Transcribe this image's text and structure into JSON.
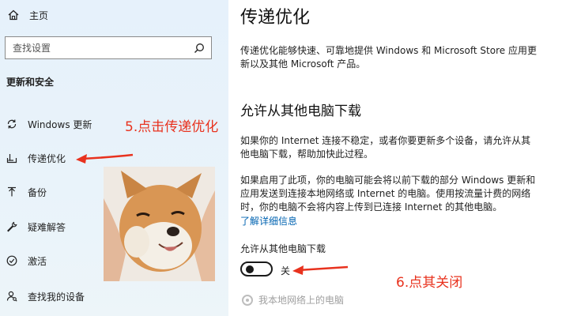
{
  "sidebar": {
    "home_label": "主页",
    "search_placeholder": "查找设置",
    "section_title": "更新和安全",
    "items": [
      {
        "label": "Windows 更新",
        "icon": "sync-icon"
      },
      {
        "label": "传递优化",
        "icon": "delivery-icon"
      },
      {
        "label": "备份",
        "icon": "backup-icon"
      },
      {
        "label": "疑难解答",
        "icon": "wrench-icon"
      },
      {
        "label": "激活",
        "icon": "check-circle-icon"
      },
      {
        "label": "查找我的设备",
        "icon": "person-locate-icon"
      }
    ]
  },
  "main": {
    "title": "传递优化",
    "desc_line1": "传递优化能够快速、可靠地提供 Windows 和 Microsoft Store 应用更",
    "desc_line2": "新以及其他 Microsoft 产品。",
    "section_heading": "允许从其他电脑下载",
    "para1_line1": "如果你的 Internet 连接不稳定，或者你要更新多个设备，请允许从其",
    "para1_line2": "他电脑下载，帮助加快此过程。",
    "para2_line1": "如果启用了此项，你的电脑可能会将以前下载的部分 Windows 更新和",
    "para2_line2": "应用发送到连接本地网络或 Internet 的电脑。使用按流量计费的网络",
    "para2_line3": "时，你的电脑不会将内容上传到已连接 Internet 的其他电脑。",
    "learn_more": "了解详细信息",
    "toggle_label": "允许从其他电脑下载",
    "toggle_state": "关",
    "radio_label": "我本地网络上的电脑"
  },
  "annotations": {
    "step5": "5.点击传递优化",
    "step6": "6.点其关闭",
    "color": "#e8321e"
  },
  "colors": {
    "sidebar_bg": "#e6f1fb",
    "link": "#0063b1"
  }
}
